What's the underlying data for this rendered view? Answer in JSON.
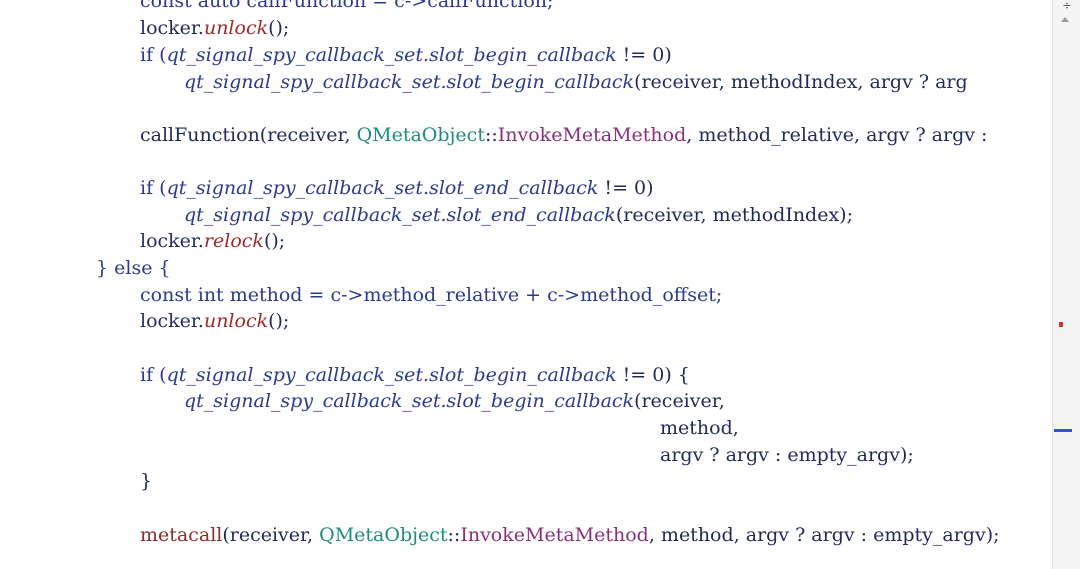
{
  "editor": {
    "lines": [
      [
        {
          "t": "const auto callFunction = c->callFunction;",
          "c": "tok-kw"
        }
      ],
      [
        {
          "t": "locker.",
          "c": "tok-plain"
        },
        {
          "t": "unlock",
          "c": "tok-method"
        },
        {
          "t": "();",
          "c": "tok-plain"
        }
      ],
      [
        {
          "t": "if (",
          "c": "tok-kw"
        },
        {
          "t": "qt_signal_spy_callback_set.slot_begin_callback",
          "c": "tok-italic"
        },
        {
          "t": " != 0)",
          "c": "tok-plain"
        }
      ],
      [
        {
          "t": "qt_signal_spy_callback_set.slot_begin_callback",
          "c": "tok-italic"
        },
        {
          "t": "(receiver, methodIndex, argv ? arg",
          "c": "tok-plain"
        }
      ],
      [],
      [
        {
          "t": "callFunction(receiver, ",
          "c": "tok-plain"
        },
        {
          "t": "QMetaObject",
          "c": "tok-type"
        },
        {
          "t": "::",
          "c": "tok-plain"
        },
        {
          "t": "InvokeMetaMethod",
          "c": "tok-fn"
        },
        {
          "t": ", method_relative, argv ? argv :",
          "c": "tok-plain"
        }
      ],
      [],
      [
        {
          "t": "if (",
          "c": "tok-kw"
        },
        {
          "t": "qt_signal_spy_callback_set.slot_end_callback",
          "c": "tok-italic"
        },
        {
          "t": " != 0)",
          "c": "tok-plain"
        }
      ],
      [
        {
          "t": "qt_signal_spy_callback_set.slot_end_callback",
          "c": "tok-italic"
        },
        {
          "t": "(receiver, methodIndex);",
          "c": "tok-plain"
        }
      ],
      [
        {
          "t": "locker.",
          "c": "tok-plain"
        },
        {
          "t": "relock",
          "c": "tok-method"
        },
        {
          "t": "();",
          "c": "tok-plain"
        }
      ],
      [
        {
          "t": "} else {",
          "c": "tok-kw"
        }
      ],
      [
        {
          "t": "const int method = c->method_relative + c->method_offset;",
          "c": "tok-kw"
        }
      ],
      [
        {
          "t": "locker.",
          "c": "tok-plain"
        },
        {
          "t": "unlock",
          "c": "tok-method"
        },
        {
          "t": "();",
          "c": "tok-plain"
        }
      ],
      [],
      [
        {
          "t": "if (",
          "c": "tok-kw"
        },
        {
          "t": "qt_signal_spy_callback_set.slot_begin_callback",
          "c": "tok-italic"
        },
        {
          "t": " != 0) {",
          "c": "tok-plain"
        }
      ],
      [
        {
          "t": "qt_signal_spy_callback_set.slot_begin_callback",
          "c": "tok-italic"
        },
        {
          "t": "(receiver,",
          "c": "tok-plain"
        }
      ],
      [
        {
          "t": "method,",
          "c": "tok-plain"
        }
      ],
      [
        {
          "t": "argv ? argv : empty_argv);",
          "c": "tok-plain"
        }
      ],
      [
        {
          "t": "}",
          "c": "tok-plain"
        }
      ],
      [],
      [
        {
          "t": "metacall",
          "c": "tok-call"
        },
        {
          "t": "(receiver, ",
          "c": "tok-plain"
        },
        {
          "t": "QMetaObject",
          "c": "tok-type"
        },
        {
          "t": "::",
          "c": "tok-plain"
        },
        {
          "t": "InvokeMetaMethod",
          "c": "tok-fn"
        },
        {
          "t": ", method, argv ? argv : empty_argv);",
          "c": "tok-plain"
        }
      ]
    ]
  },
  "scrollbar": {
    "split_handle_glyph": "÷",
    "error_marker_color": "#c0392b",
    "position_marker_color": "#3355cc"
  }
}
